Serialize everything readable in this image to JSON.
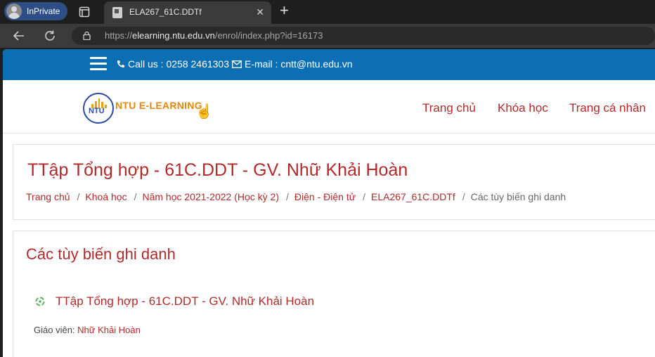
{
  "browser": {
    "inprivate_label": "InPrivate",
    "tab_title": "ELA267_61C.DDTf",
    "close_glyph": "✕",
    "newtab_glyph": "+",
    "url_host": "elearning.ntu.edu.vn",
    "url_prefix": "https://",
    "url_path": "/enrol/index.php?id=16173"
  },
  "topbar": {
    "call_text": "Call us : 0258 2461303",
    "email_text": "E-mail : cntt@ntu.edu.vn",
    "bg_color": "#0c6fb3"
  },
  "header": {
    "logo_short": "NTU",
    "logo_brand": "NTU E-LEARNING",
    "nav": [
      "Trang chủ",
      "Khóa học",
      "Trang cá nhân"
    ]
  },
  "page_header": {
    "title": "TTập Tổng hợp - 61C.DDT - GV. Nhữ Khải Hoàn",
    "breadcrumb": [
      "Trang chủ",
      "Khoá học",
      "Năm học 2021-2022 (Học kỳ 2)",
      "Điện - Điện tử",
      "ELA267_61C.DDTf"
    ],
    "breadcrumb_current": "Các tùy biến ghi danh",
    "breadcrumb_sep": "/"
  },
  "enrol": {
    "heading": "Các tùy biến ghi danh",
    "course_name": "TTập Tổng hợp - 61C.DDT - GV. Nhữ Khải Hoàn",
    "teacher_label": "Giáo viên: ",
    "teacher_name": "Nhữ Khải Hoàn"
  },
  "colors": {
    "accent": "#b12a2a",
    "chrome_dark": "#1f1f1f",
    "chrome_mid": "#3b3b3b"
  }
}
